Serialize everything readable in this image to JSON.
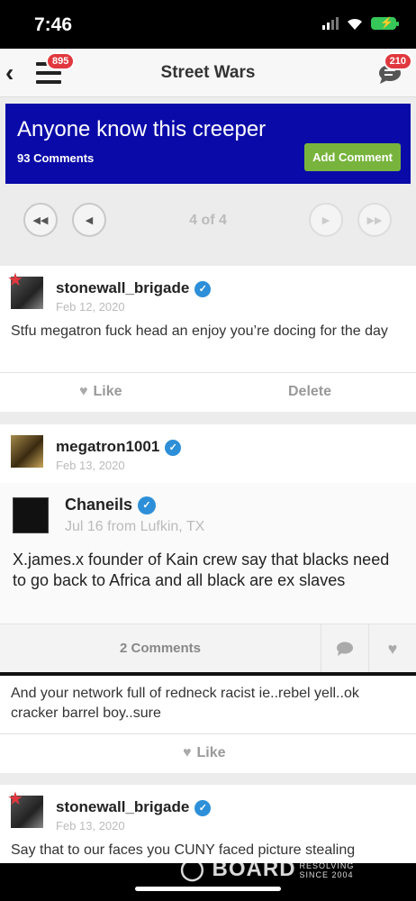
{
  "status": {
    "time": "7:46"
  },
  "nav": {
    "title": "Street Wars",
    "menu_badge": "895",
    "chat_badge": "210"
  },
  "thread": {
    "title": "Anyone know this creeper",
    "comment_count": "93 Comments",
    "add_comment_label": "Add Comment"
  },
  "pager": {
    "label": "4 of 4"
  },
  "posts": [
    {
      "user": "stonewall_brigade",
      "date": "Feb 12, 2020",
      "text": "Stfu megatron fuck head an enjoy you’re docing for the day",
      "like_label": "Like",
      "delete_label": "Delete"
    },
    {
      "user": "megatron1001",
      "date": "Feb 13, 2020",
      "repost": {
        "user": "Chaneils",
        "meta": "Jul 16 from Lufkin, TX",
        "text": "X.james.x founder of Kain crew say that blacks need to go back to Africa and all black are ex slaves",
        "comments_label": "2 Comments"
      },
      "text": "And your network full of redneck racist ie..rebel yell..ok cracker barrel boy..sure",
      "like_label": "Like"
    },
    {
      "user": "stonewall_brigade",
      "date": "Feb 13, 2020",
      "text": "Say that to our faces you CUNY faced picture stealing"
    }
  ],
  "watermark": {
    "word": "BOARD",
    "tag_line1": "RESOLVING",
    "tag_line2": "SINCE 2004"
  }
}
